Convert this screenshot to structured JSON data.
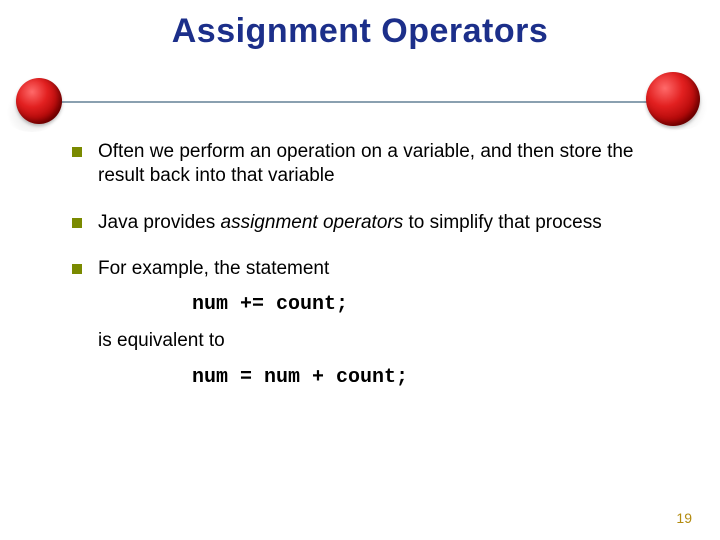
{
  "title": "Assignment Operators",
  "bullets": [
    {
      "pre": "Often we perform an operation on a variable, and then store the result back into that variable",
      "italic": "",
      "post": ""
    },
    {
      "pre": "Java provides ",
      "italic": "assignment operators",
      "post": " to simplify that process"
    },
    {
      "pre": "For example, the statement",
      "italic": "",
      "post": ""
    }
  ],
  "code1": "num += count;",
  "equiv_text": "is equivalent to",
  "code2": "num = num + count;",
  "page_number": "19"
}
